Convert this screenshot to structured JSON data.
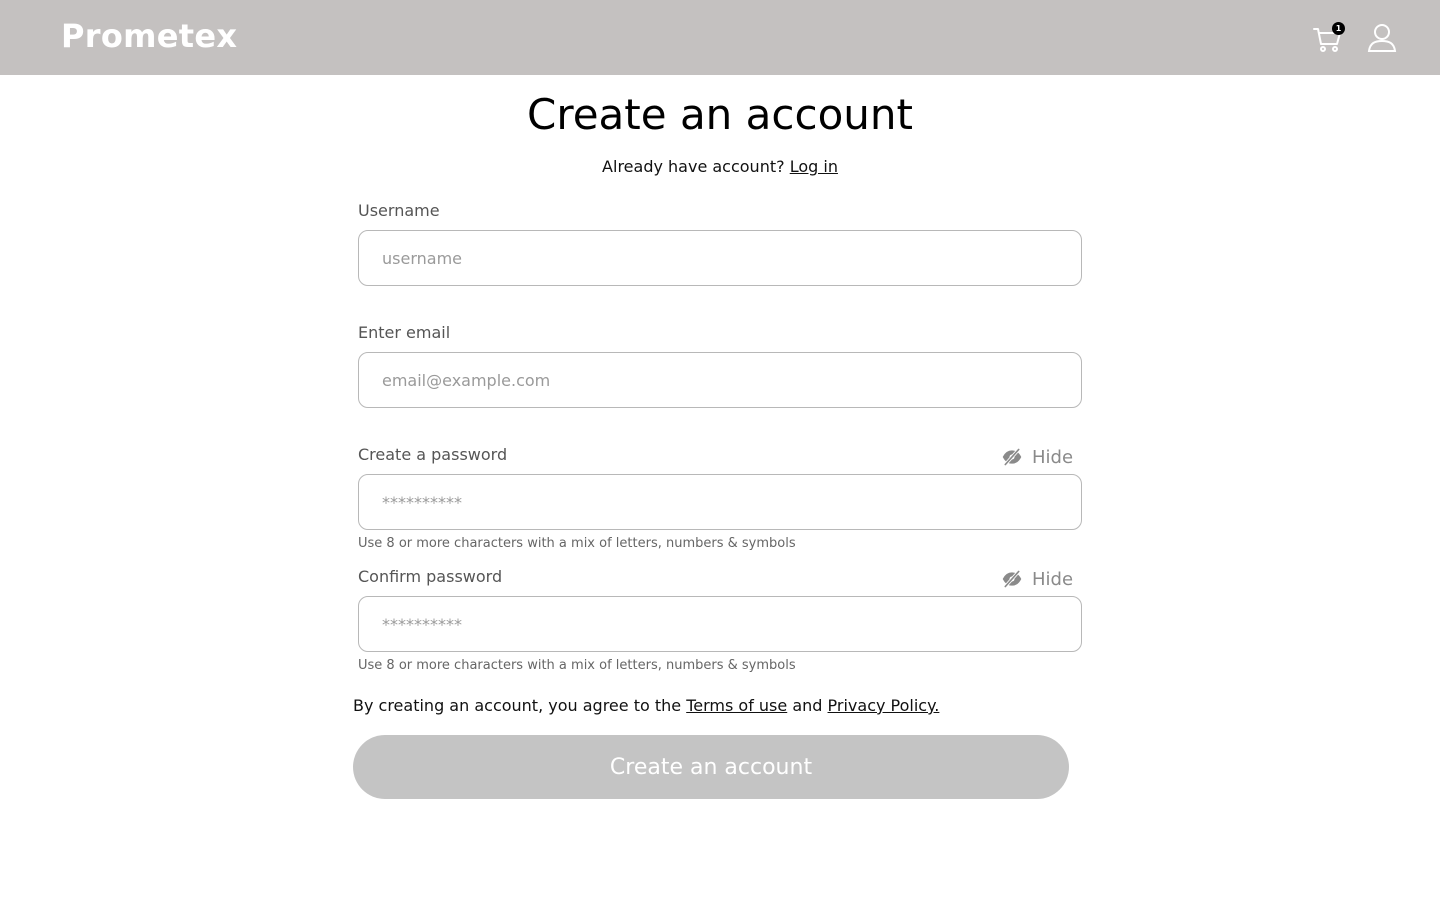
{
  "header": {
    "brand": "Prometex",
    "cart_count": "1",
    "cart_icon": "cart-icon",
    "user_icon": "user-icon"
  },
  "page": {
    "title": "Create an account",
    "login_prompt": "Already have account?",
    "login_link": "Log in"
  },
  "form": {
    "username": {
      "label": "Username",
      "placeholder": "username",
      "value": ""
    },
    "email": {
      "label": "Enter email",
      "placeholder": "email@example.com",
      "value": ""
    },
    "password": {
      "label": "Create a password",
      "toggle_label": "Hide",
      "toggle_icon": "eye-slash-icon",
      "placeholder": "**********",
      "hint": "Use 8 or more characters with a mix of letters, numbers & symbols"
    },
    "confirm_password": {
      "label": "Confirm password",
      "toggle_label": "Hide",
      "toggle_icon": "eye-slash-icon",
      "placeholder": "**********",
      "hint": "Use 8 or more characters with a mix of letters, numbers & symbols"
    },
    "agreement": {
      "prefix": "By creating an account, you agree to the",
      "terms_link": "Terms of use",
      "conjunction": "and",
      "privacy_link": "Privacy Policy."
    },
    "submit_label": "Create an account"
  },
  "colors": {
    "header_bg": "#c4c1c0",
    "button_disabled_bg": "#c4c4c4",
    "border": "#b8b8b8"
  }
}
